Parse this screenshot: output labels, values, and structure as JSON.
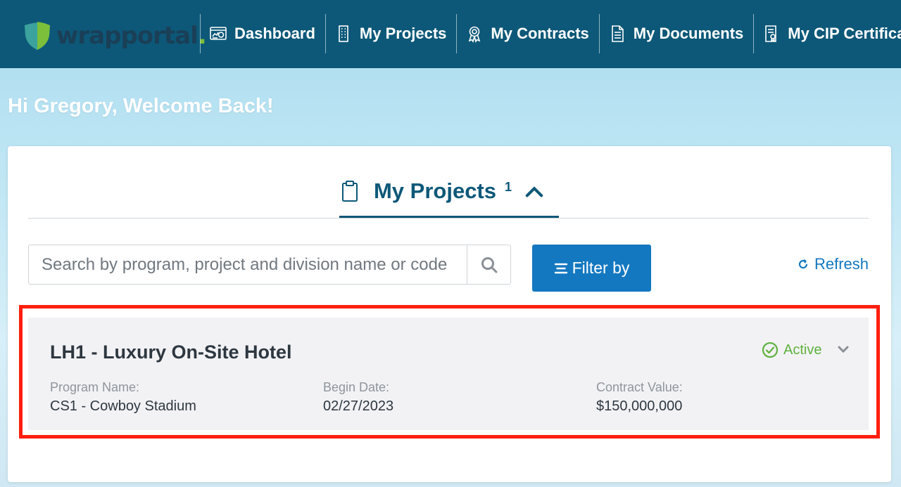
{
  "brand": {
    "name": "wrapportal",
    "mark": ".",
    "accent": "#7bbf3a",
    "primary": "#0d5878"
  },
  "nav": {
    "items": [
      {
        "label": "Dashboard",
        "icon": "dashboard-icon"
      },
      {
        "label": "My Projects",
        "icon": "building-icon"
      },
      {
        "label": "My Contracts",
        "icon": "award-icon"
      },
      {
        "label": "My Documents",
        "icon": "document-icon"
      },
      {
        "label": "My CIP Certificates",
        "icon": "certificate-icon"
      }
    ]
  },
  "welcome": "Hi Gregory, Welcome Back!",
  "tab": {
    "label": "My Projects",
    "count": "1",
    "icon": "clipboard-icon"
  },
  "search": {
    "placeholder": "Search by program, project and division name or code",
    "value": ""
  },
  "filter": {
    "label": "Filter by"
  },
  "refresh": {
    "label": "Refresh"
  },
  "project": {
    "title": "LH1 - Luxury On-Site Hotel",
    "status": "Active",
    "status_color": "#5fb13e",
    "fields": [
      {
        "label": "Program Name:",
        "value": "CS1 - Cowboy Stadium"
      },
      {
        "label": "Begin Date:",
        "value": "02/27/2023"
      },
      {
        "label": "Contract Value:",
        "value": "$150,000,000"
      }
    ]
  }
}
